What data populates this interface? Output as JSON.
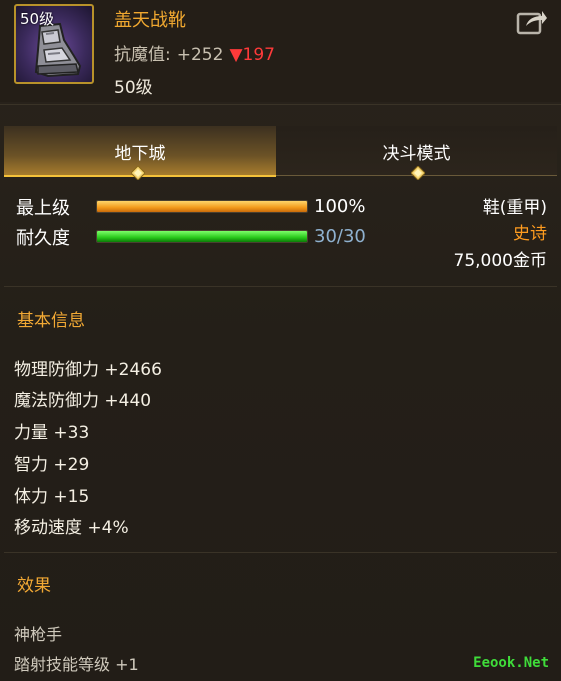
{
  "item": {
    "icon_level": "50级",
    "name": "盖天战靴",
    "resist_label": "抗魔值:",
    "resist_value": "+252",
    "resist_diff": "▼197",
    "required_level": "50级"
  },
  "tabs": [
    {
      "label": "地下城",
      "active": true
    },
    {
      "label": "决斗模式",
      "active": false
    }
  ],
  "bars": {
    "grade": {
      "label": "最上级",
      "value_text": "100%",
      "fraction": 1.0
    },
    "durability": {
      "label": "耐久度",
      "value_text": "30/30",
      "fraction": 1.0
    }
  },
  "meta": {
    "type": "鞋(重甲)",
    "rarity": "史诗",
    "price": "75,000金币"
  },
  "basic": {
    "title": "基本信息",
    "stats": [
      "物理防御力 +2466",
      "魔法防御力 +440",
      "力量 +33",
      "智力 +29",
      "体力 +15",
      "移动速度 +4%"
    ]
  },
  "effects": {
    "title": "效果",
    "lines": [
      "神枪手",
      "踏射技能等级 +1"
    ]
  },
  "watermark": "Eeook.Net",
  "colors": {
    "title_gold": "#f0a830",
    "epic_orange": "#ff9c1f",
    "down_red": "#ff3a3a",
    "bar_orange": "#f39a1a",
    "bar_green": "#28c81a"
  },
  "icons": [
    "boots-icon",
    "share-icon",
    "tab-marker-icon"
  ]
}
